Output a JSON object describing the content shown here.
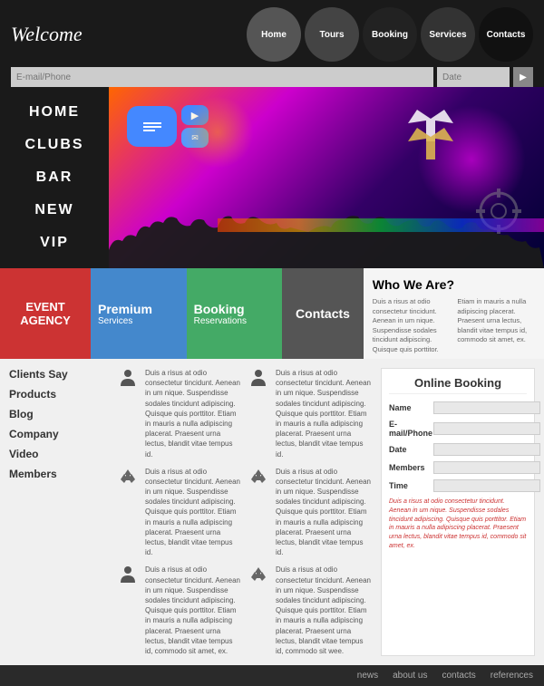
{
  "header": {
    "title": "Welcome",
    "search_placeholder": "E-mail/Phone",
    "date_placeholder": "Date",
    "search_btn": "▶"
  },
  "nav": {
    "items": [
      {
        "label": "Home",
        "class": "home"
      },
      {
        "label": "Tours",
        "class": "tours"
      },
      {
        "label": "Booking",
        "class": "booking"
      },
      {
        "label": "Services",
        "class": "services"
      },
      {
        "label": "Contacts",
        "class": "contacts"
      }
    ]
  },
  "left_nav": {
    "items": [
      {
        "label": "HOME"
      },
      {
        "label": "CLUBS"
      },
      {
        "label": "BAR"
      },
      {
        "label": "NEW"
      },
      {
        "label": "VIP"
      }
    ]
  },
  "services": {
    "event_agency": "EVENT\nAGENCY",
    "premium_title": "Premium",
    "premium_sub": "Services",
    "booking_title": "Booking",
    "booking_sub": "Reservations",
    "contacts": "Contacts",
    "who_title": "Who We Are?",
    "who_text1": "Duis a risus at odio consectetur tincidunt. Aenean in um nique. Suspendisse sodales tincidunt adipiscing. Quisque quis porttitor. Etiam in mauris a nulla adipiscing placerat. Praesent urna lectus, blandit vitae tempus id, commodo sit amet, ex.",
    "who_text2": "Duis a risus at odio consectetur tincidunt. Aenean in um nique. Suspendisse sodales tincidunt adipiscing. Quisque quis porttitor. Etiam in mauris a nulla adipiscing placerat. Praesent urna lectus, blandit vitae tempus id, commodo sit amet, ex."
  },
  "sidebar_links": [
    {
      "label": "Clients Say"
    },
    {
      "label": "Products"
    },
    {
      "label": "Blog"
    },
    {
      "label": "Company"
    },
    {
      "label": "Video"
    },
    {
      "label": "Members"
    }
  ],
  "content_items": [
    {
      "icon": "person",
      "text": "Duis a risus at odio consectetur tincidunt. Aenean in um nique. Suspendisse sodales tincidunt adipiscing. Quisque quis porttitor. Etiam in mauris a nulla adipiscing placerat. Praesent urna lectus, blandit vitae tempus id."
    },
    {
      "icon": "person",
      "text": "Duis a risus at odio consectetur tincidunt. Aenean in um nique. Suspendisse sodales tincidunt adipiscing. Quisque quis porttitor. Etiam in mauris a nulla adipiscing placerat. Praesent urna lectus, blandit vitae tempus id."
    },
    {
      "icon": "recycle",
      "text": "Duis a risus at odio consectetur tincidunt. Aenean in um nique. Suspendisse sodales tincidunt adipiscing. Quisque quis porttitor. Etiam in mauris a nulla adipiscing placerat. Praesent urna lectus, blandit vitae tempus id."
    },
    {
      "icon": "recycle",
      "text": "Duis a risus at odio consectetur tincidunt. Aenean in um nique. Suspendisse sodales tincidunt adipiscing. Quisque quis porttitor. Etiam in mauris a nulla adipiscing placerat. Praesent urna lectus, blandit vitae tempus id."
    },
    {
      "icon": "person2",
      "text": "Duis a risus at odio consectetur tincidunt. Aenean in um nique. Suspendisse sodales tincidunt adipiscing. Quisque quis porttitor. Etiam in mauris a nulla adipiscing placerat. Praesent urna lectus, blandit vitae tempus id, commodo sit amet, ex."
    },
    {
      "icon": "recycle2",
      "text": "Duis a risus at odio consectetur tincidunt. Aenean in um nique. Suspendisse sodales tincidunt adipiscing. Quisque quis porttitor. Etiam in mauris a nulla adipiscing placerat. Praesent urna lectus, blandit vitae tempus id, commodo sit wee."
    }
  ],
  "booking": {
    "title": "Online Booking",
    "fields": [
      {
        "label": "Name",
        "value": ""
      },
      {
        "label": "E-mail/Phone",
        "value": ""
      },
      {
        "label": "Date",
        "value": ""
      },
      {
        "label": "Members",
        "value": ""
      },
      {
        "label": "Time",
        "value": ""
      }
    ],
    "note": "Duis a risus at odio consectetur tincidunt. Aenean in um nique. Suspendisse sodales tincidunt adipiscing. Quisque quis porttitor. Etiam in mauris a nulla adipiscing placerat. Praesent urna lectus, blandit vitae tempus id, commodo sit amet, ex."
  },
  "footer": {
    "links": [
      "news",
      "about us",
      "contacts",
      "references"
    ]
  }
}
